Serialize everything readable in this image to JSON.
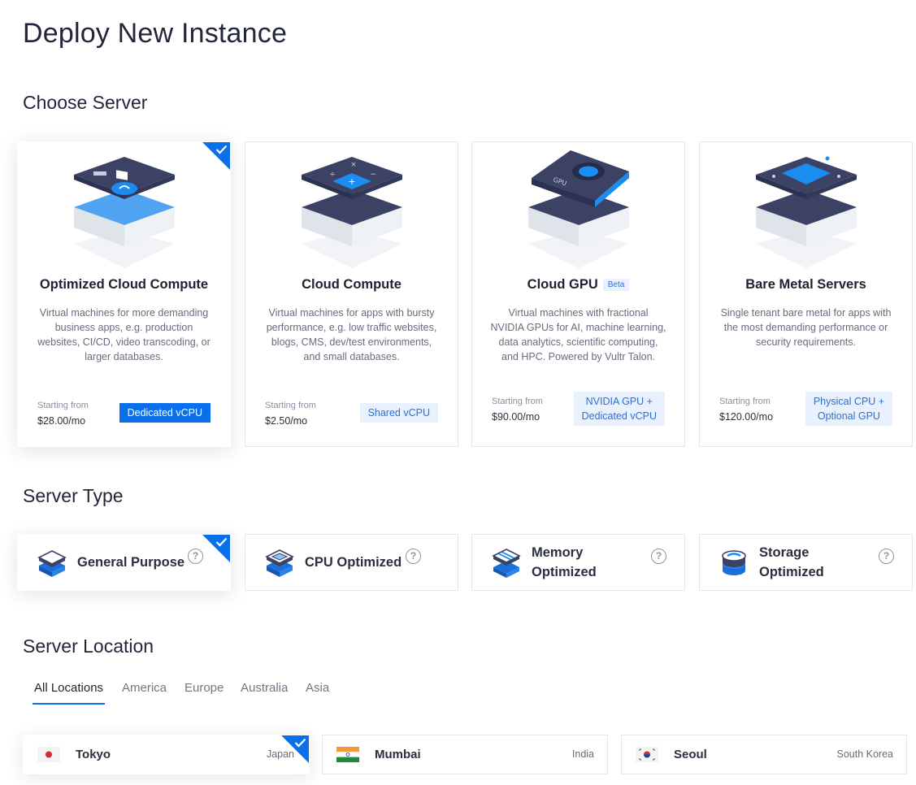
{
  "page": {
    "title": "Deploy New Instance"
  },
  "sections": {
    "choose_server": "Choose Server",
    "server_type": "Server Type",
    "server_location": "Server Location"
  },
  "servers": [
    {
      "title": "Optimized Cloud Compute",
      "description": "Virtual machines for more demanding business apps, e.g. production websites, CI/CD, video transcoding, or larger databases.",
      "price_label": "Starting from",
      "price": "$28.00/mo",
      "tag": "Dedicated vCPU",
      "selected": true
    },
    {
      "title": "Cloud Compute",
      "description": "Virtual machines for apps with bursty performance, e.g. low traffic websites, blogs, CMS, dev/test environments, and small databases.",
      "price_label": "Starting from",
      "price": "$2.50/mo",
      "tag": "Shared vCPU",
      "selected": false
    },
    {
      "title": "Cloud GPU",
      "badge": "Beta",
      "description": "Virtual machines with fractional NVIDIA GPUs for AI, machine learning, data analytics, scientific computing, and HPC. Powered by Vultr Talon.",
      "price_label": "Starting from",
      "price": "$90.00/mo",
      "tag_line1": "NVIDIA GPU +",
      "tag_line2": "Dedicated vCPU",
      "illus_text": "GPU",
      "selected": false
    },
    {
      "title": "Bare Metal Servers",
      "description": "Single tenant bare metal for apps with the most demanding performance or security requirements.",
      "price_label": "Starting from",
      "price": "$120.00/mo",
      "tag_line1": "Physical CPU +",
      "tag_line2": "Optional GPU",
      "selected": false
    }
  ],
  "server_types": [
    {
      "label": "General Purpose",
      "selected": true,
      "icon": "stack-layers-icon"
    },
    {
      "label": "CPU Optimized",
      "selected": false,
      "icon": "cpu-chip-icon"
    },
    {
      "label_line1": "Memory",
      "label_line2": "Optimized",
      "selected": false,
      "icon": "memory-module-icon"
    },
    {
      "label_line1": "Storage",
      "label_line2": "Optimized",
      "selected": false,
      "icon": "storage-disk-icon"
    }
  ],
  "help_glyph": "?",
  "location_tabs": [
    "All Locations",
    "America",
    "Europe",
    "Australia",
    "Asia"
  ],
  "active_tab": "All Locations",
  "locations": [
    {
      "city": "Tokyo",
      "country": "Japan",
      "selected": true
    },
    {
      "city": "Mumbai",
      "country": "India",
      "selected": false
    },
    {
      "city": "Seoul",
      "country": "South Korea",
      "selected": false
    }
  ],
  "colors": {
    "accent": "#0a6fe8",
    "tag_bg": "#e8f1fd",
    "tag_text": "#2e6fd4",
    "illus_dark": "#3b4263",
    "illus_light": "#eef1f6"
  }
}
